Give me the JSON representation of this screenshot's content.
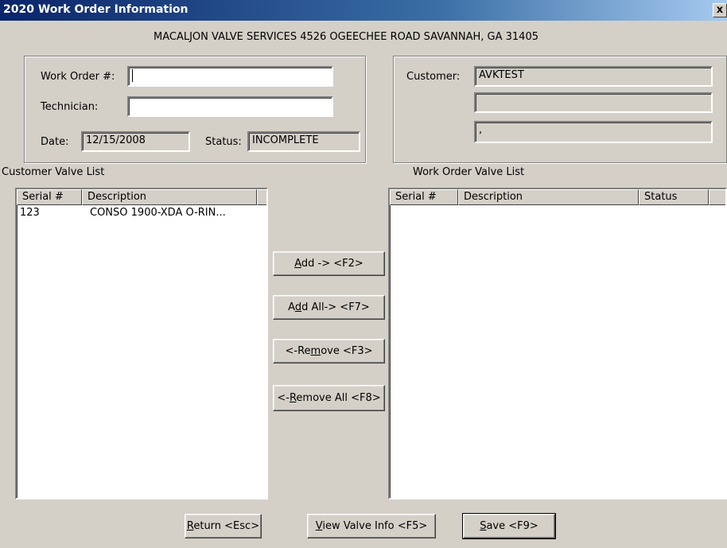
{
  "window": {
    "title": "2020 Work Order Information",
    "close_glyph": "x"
  },
  "company_line": "MACALJON VALVE SERVICES 4526 OGEECHEE ROAD SAVANNAH, GA 31405",
  "order": {
    "work_order_label": "Work Order #:",
    "work_order_value": "",
    "technician_label": "Technician:",
    "technician_value": "",
    "date_label": "Date:",
    "date_value": "12/15/2008",
    "status_label": "Status:",
    "status_value": "INCOMPLETE"
  },
  "customer": {
    "label": "Customer:",
    "name": "AVKTEST",
    "line2": "",
    "line3": ","
  },
  "customer_valve_list": {
    "caption": "Customer Valve List",
    "columns": [
      "Serial #",
      "Description"
    ],
    "rows": [
      {
        "serial": "123",
        "description": "CONSO  1900-XDA O-RIN..."
      }
    ]
  },
  "work_order_valve_list": {
    "caption": "Work Order Valve List",
    "columns": [
      "Serial #",
      "Description",
      "Status"
    ],
    "rows": []
  },
  "transfer_buttons": {
    "add": {
      "pre": "",
      "key": "A",
      "post": "dd -> <F2>"
    },
    "add_all": {
      "pre": "A",
      "key": "d",
      "post": "d All-> <F7>"
    },
    "remove": {
      "pre": "<-Re",
      "key": "m",
      "post": "ove <F3>"
    },
    "remove_all": {
      "pre": "<-",
      "key": "R",
      "post": "emove All <F8>"
    }
  },
  "footer_buttons": {
    "return": {
      "pre": "",
      "key": "R",
      "post": "eturn <Esc>"
    },
    "view": {
      "pre": "",
      "key": "V",
      "post": "iew Valve Info <F5>"
    },
    "save": {
      "pre": "",
      "key": "S",
      "post": "ave <F9>"
    }
  }
}
